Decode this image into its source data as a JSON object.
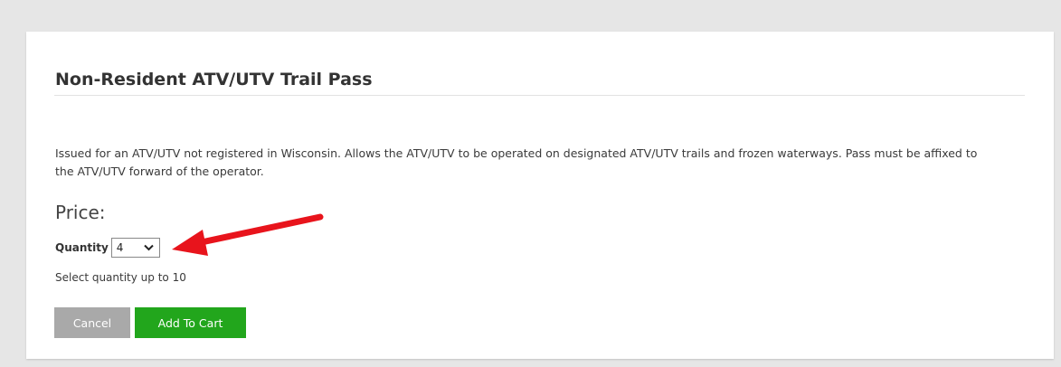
{
  "product": {
    "title": "Non-Resident ATV/UTV Trail Pass",
    "description": "Issued for an ATV/UTV not registered in Wisconsin. Allows the ATV/UTV to be operated on designated ATV/UTV trails and frozen waterways. Pass must be affixed to the ATV/UTV forward of the operator.",
    "price_label": "Price:"
  },
  "quantity": {
    "label": "Quantity",
    "selected_value": "4",
    "hint": "Select quantity up to 10"
  },
  "actions": {
    "cancel_label": "Cancel",
    "add_to_cart_label": "Add To Cart"
  },
  "colors": {
    "page_background": "#e6e6e6",
    "card_background": "#ffffff",
    "cancel_button": "#a9a9a9",
    "add_to_cart_button": "#22a61c",
    "annotation_arrow": "#e8141c"
  },
  "icons": {
    "select_caret": "chevron-down-icon",
    "annotation": "red-arrow-icon"
  }
}
